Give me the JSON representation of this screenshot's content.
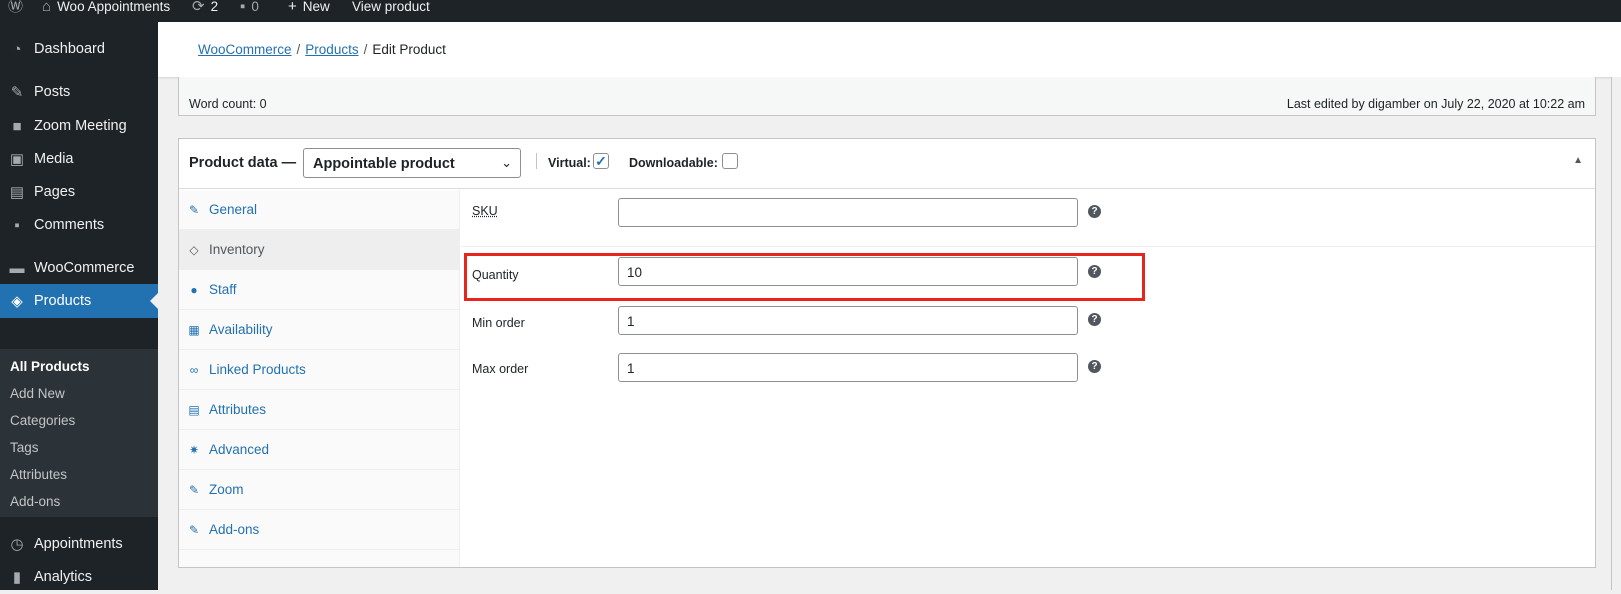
{
  "adminbar": {
    "site_name": "Woo Appointments",
    "updates_count": "2",
    "comments_count": "0",
    "new_label": "New",
    "view_label": "View product"
  },
  "menu": {
    "items": [
      {
        "label": "Dashboard",
        "icon": "dashboard-icon"
      },
      {
        "label": "Posts",
        "icon": "pin-icon"
      },
      {
        "label": "Zoom Meeting",
        "icon": "video-icon"
      },
      {
        "label": "Media",
        "icon": "media-icon"
      },
      {
        "label": "Pages",
        "icon": "pages-icon"
      },
      {
        "label": "Comments",
        "icon": "comments-icon"
      },
      {
        "label": "WooCommerce",
        "icon": "woo-icon"
      },
      {
        "label": "Products",
        "icon": "box-icon"
      },
      {
        "label": "Appointments",
        "icon": "clock-icon"
      },
      {
        "label": "Analytics",
        "icon": "chart-icon"
      }
    ],
    "submenu": [
      "All Products",
      "Add New",
      "Categories",
      "Tags",
      "Attributes",
      "Add-ons"
    ]
  },
  "breadcrumb": {
    "woo": "WooCommerce",
    "products": "Products",
    "current": "Edit Product",
    "sep": "/"
  },
  "editor": {
    "word_count": "Word count: 0",
    "last_edited": "Last edited by digamber on July 22, 2020 at 10:22 am"
  },
  "product_data": {
    "title": "Product data —",
    "type": "Appointable product",
    "virtual_label": "Virtual:",
    "virtual_checked": true,
    "downloadable_label": "Downloadable:",
    "downloadable_checked": false,
    "tabs": [
      {
        "label": "General",
        "icon": "wrench-icon"
      },
      {
        "label": "Inventory",
        "icon": "tag-icon"
      },
      {
        "label": "Staff",
        "icon": "person-icon"
      },
      {
        "label": "Availability",
        "icon": "calendar-icon"
      },
      {
        "label": "Linked Products",
        "icon": "link-icon"
      },
      {
        "label": "Attributes",
        "icon": "list-icon"
      },
      {
        "label": "Advanced",
        "icon": "gear-icon"
      },
      {
        "label": "Zoom",
        "icon": "wrench-icon"
      },
      {
        "label": "Add-ons",
        "icon": "wrench-icon"
      }
    ],
    "selected_tab": "Inventory",
    "fields": {
      "sku": {
        "label": "SKU",
        "value": ""
      },
      "quantity": {
        "label": "Quantity",
        "value": "10"
      },
      "min_order": {
        "label": "Min order",
        "value": "1"
      },
      "max_order": {
        "label": "Max order",
        "value": "1"
      }
    }
  },
  "colors": {
    "accent": "#2271b1",
    "highlight": "#e8251a",
    "adminbar": "#1d2327"
  }
}
